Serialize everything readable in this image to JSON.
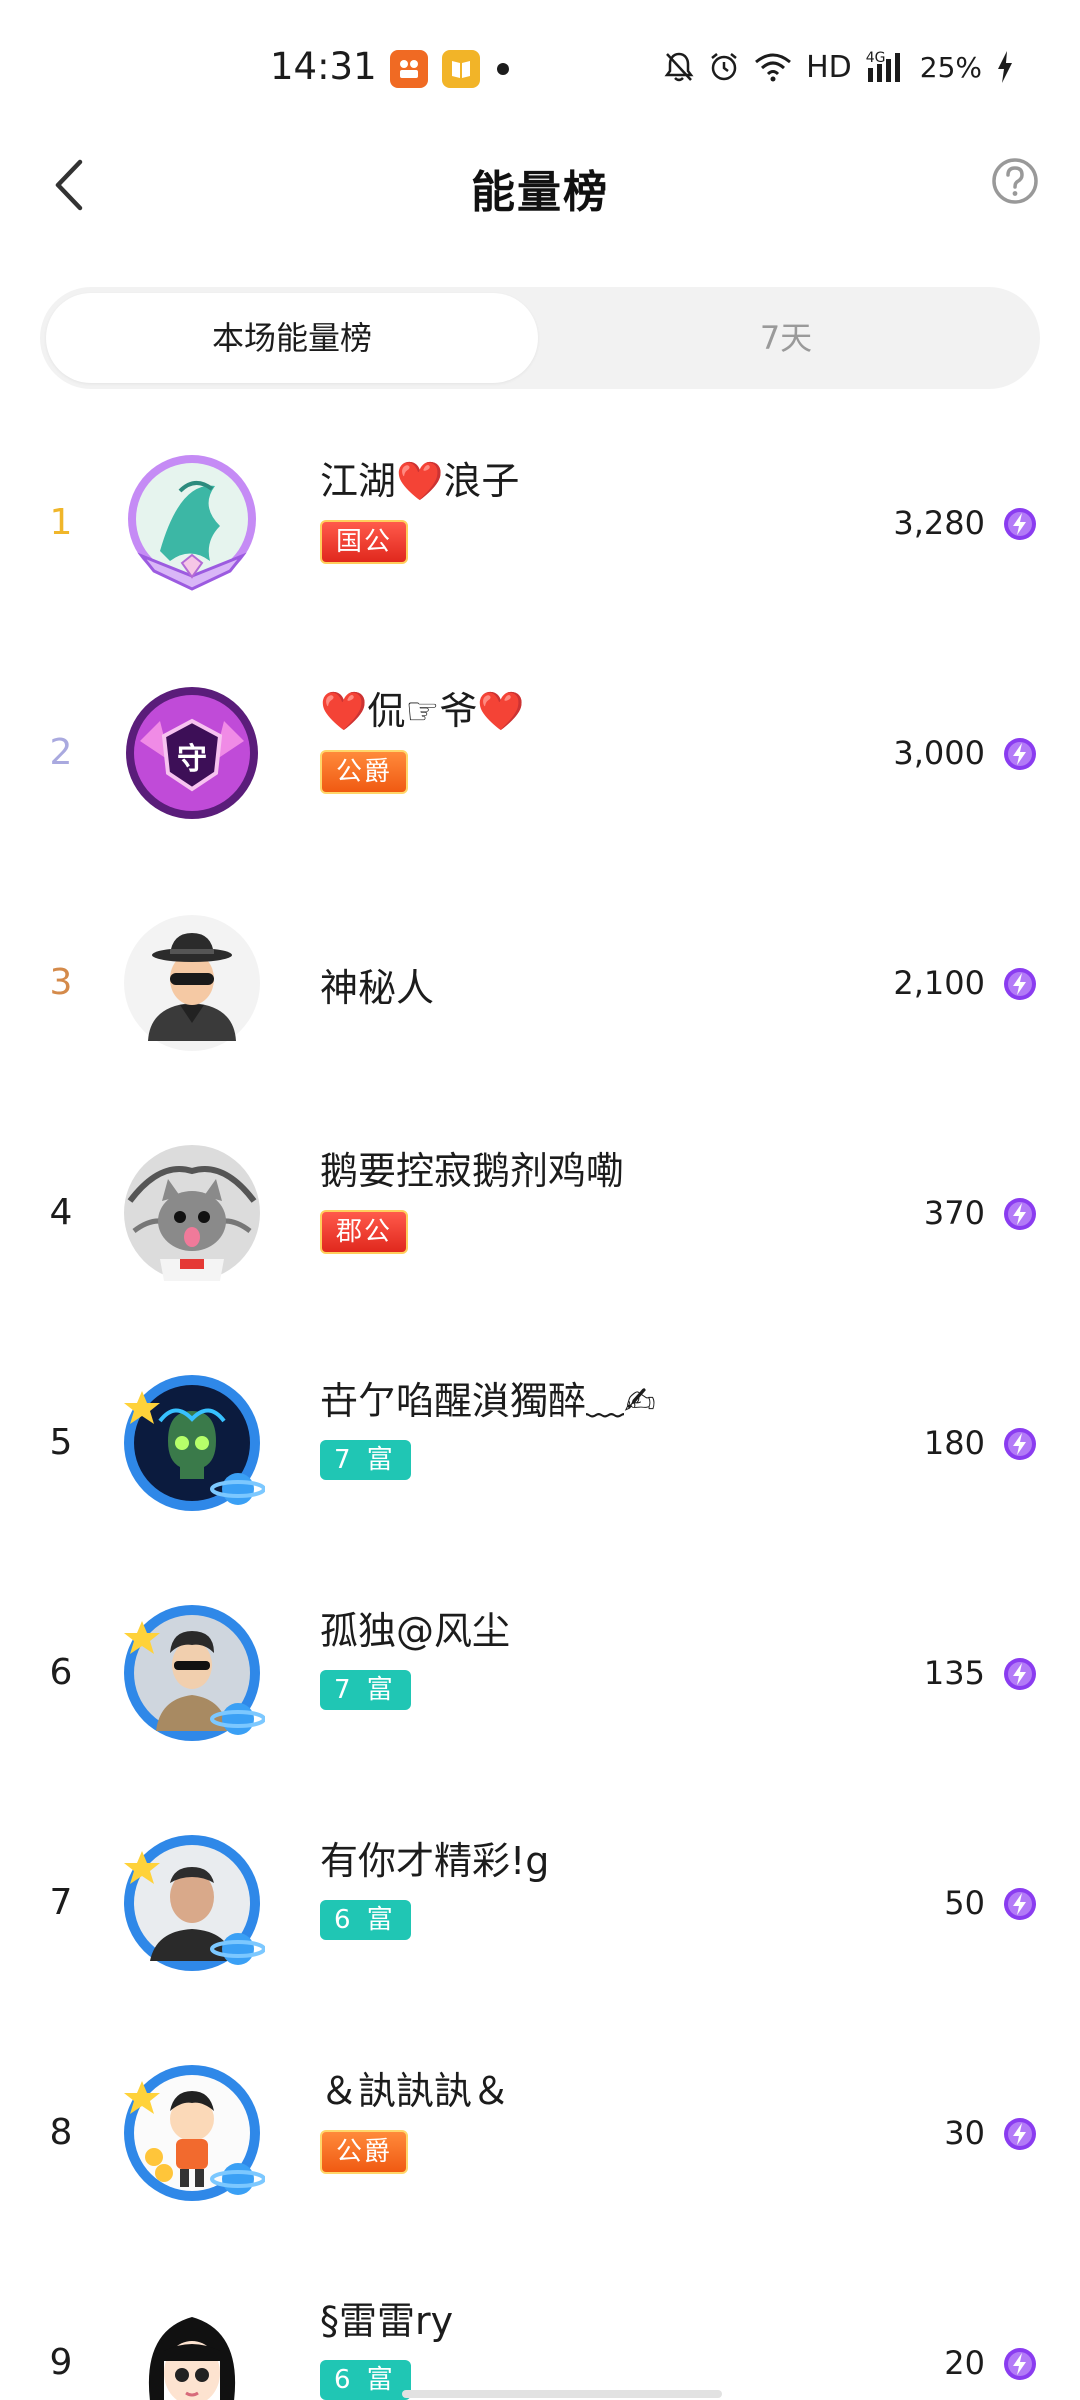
{
  "status_bar": {
    "time": "14:31",
    "app_icons": [
      "orange-app-icon",
      "yellow-book-icon"
    ],
    "signal_label": "4G",
    "hd_label": "HD",
    "battery": "25%"
  },
  "header": {
    "title": "能量榜",
    "back_icon": "chevron-left-icon",
    "help_icon": "question-circle-icon"
  },
  "tabs": [
    {
      "label": "本场能量榜",
      "active": true
    },
    {
      "label": "7天",
      "active": false
    }
  ],
  "ranking": [
    {
      "rank": "1",
      "name": "江湖❤️浪子",
      "badge": "国公",
      "badge_style": "red",
      "score": "3,280",
      "rank_color": "#f0b62a"
    },
    {
      "rank": "2",
      "name": "❤️侃☞爷❤️",
      "badge": "公爵",
      "badge_style": "orange",
      "score": "3,000",
      "rank_color": "#a9a9df"
    },
    {
      "rank": "3",
      "name": "神秘人",
      "badge": "",
      "badge_style": "",
      "score": "2,100",
      "rank_color": "#d48a4a"
    },
    {
      "rank": "4",
      "name": "鹅要控寂鹅剂鸡嘞",
      "badge": "郡公",
      "badge_style": "red",
      "score": "370",
      "rank_color": "#1c1c1c"
    },
    {
      "rank": "5",
      "name": "卋亇啗醒溑獨醉﹏✍",
      "badge": "7 富",
      "badge_style": "teal",
      "score": "180",
      "rank_color": "#1c1c1c"
    },
    {
      "rank": "6",
      "name": "孤独@风尘",
      "badge": "7 富",
      "badge_style": "teal",
      "score": "135",
      "rank_color": "#1c1c1c"
    },
    {
      "rank": "7",
      "name": "有你才精彩!g",
      "badge": "6 富",
      "badge_style": "teal",
      "score": "50",
      "rank_color": "#1c1c1c"
    },
    {
      "rank": "8",
      "name": "＆訙訙訙＆",
      "badge": "公爵",
      "badge_style": "orange",
      "score": "30",
      "rank_color": "#1c1c1c"
    },
    {
      "rank": "9",
      "name": "§雷雷ry",
      "badge": "6 富",
      "badge_style": "teal",
      "score": "20",
      "rank_color": "#1c1c1c"
    }
  ],
  "colors": {
    "energy_icon": "#8a3cf0",
    "teal_badge": "#20c6b4",
    "red_badge": "#e0281d",
    "orange_badge": "#f05a12"
  }
}
